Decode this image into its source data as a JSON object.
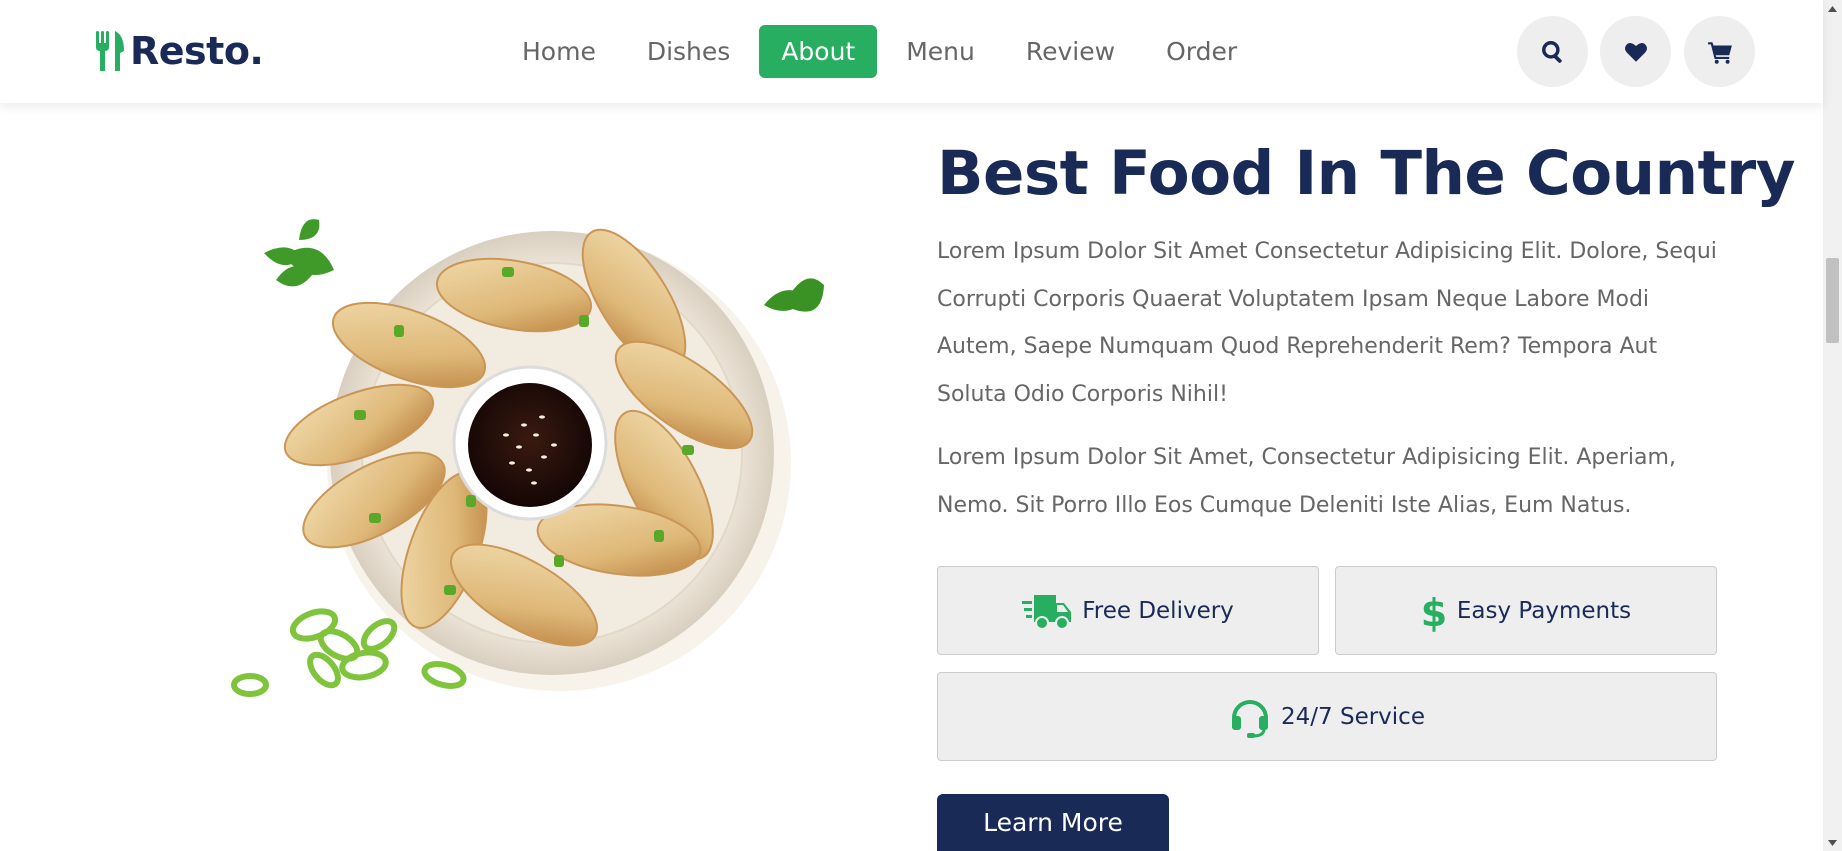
{
  "brand": {
    "name": "Resto.",
    "accent": "#27ae60",
    "navy": "#192a56"
  },
  "nav": {
    "items": [
      {
        "label": "Home"
      },
      {
        "label": "Dishes"
      },
      {
        "label": "About",
        "active": true
      },
      {
        "label": "Menu"
      },
      {
        "label": "Review"
      },
      {
        "label": "Order"
      }
    ]
  },
  "header_icons": [
    "search-icon",
    "heart-icon",
    "cart-icon"
  ],
  "about": {
    "title": "Best Food In The Country",
    "paragraph1": "Lorem Ipsum Dolor Sit Amet Consectetur Adipisicing Elit. Dolore, Sequi Corrupti Corporis Quaerat Voluptatem Ipsam Neque Labore Modi Autem, Saepe Numquam Quod Reprehenderit Rem? Tempora Aut Soluta Odio Corporis Nihil!",
    "paragraph2": "Lorem Ipsum Dolor Sit Amet, Consectetur Adipisicing Elit. Aperiam, Nemo. Sit Porro Illo Eos Cumque Deleniti Iste Alias, Eum Natus.",
    "features": [
      {
        "icon": "truck-icon",
        "label": "Free Delivery"
      },
      {
        "icon": "dollar-icon",
        "label": "Easy Payments"
      },
      {
        "icon": "headset-icon",
        "label": "24/7 Service"
      }
    ],
    "cta": "Learn More"
  }
}
